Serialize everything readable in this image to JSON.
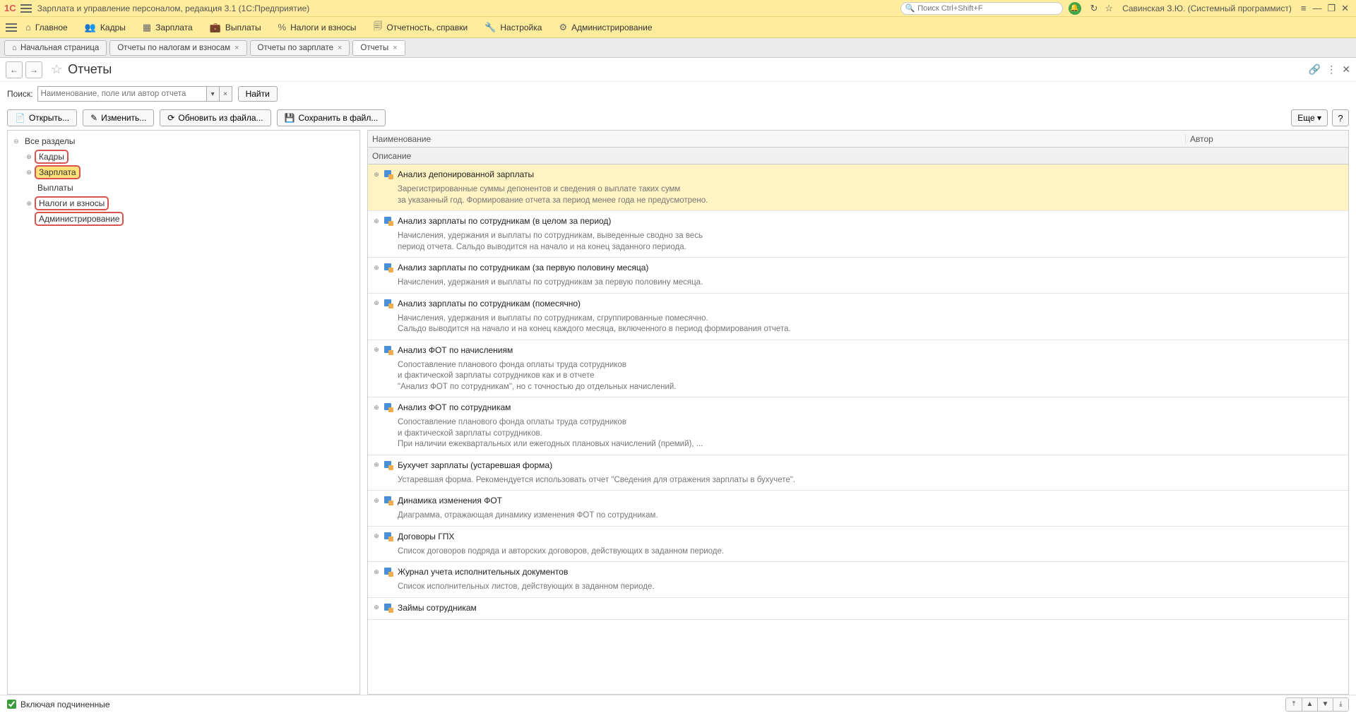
{
  "titlebar": {
    "logo": "1C",
    "title": "Зарплата и управление персоналом, редакция 3.1  (1С:Предприятие)",
    "search_placeholder": "Поиск Ctrl+Shift+F",
    "user": "Савинская З.Ю. (Системный программист)"
  },
  "mainmenu": [
    {
      "icon": "⌂",
      "label": "Главное"
    },
    {
      "icon": "👥",
      "label": "Кадры"
    },
    {
      "icon": "▦",
      "label": "Зарплата"
    },
    {
      "icon": "💼",
      "label": "Выплаты"
    },
    {
      "icon": "%",
      "label": "Налоги и взносы"
    },
    {
      "icon": "🗐",
      "label": "Отчетность, справки"
    },
    {
      "icon": "🔧",
      "label": "Настройка"
    },
    {
      "icon": "⚙",
      "label": "Администрирование"
    }
  ],
  "tabs": {
    "home": "Начальная страница",
    "items": [
      {
        "label": "Отчеты по налогам и взносам",
        "active": false
      },
      {
        "label": "Отчеты по зарплате",
        "active": false
      },
      {
        "label": "Отчеты",
        "active": true
      }
    ]
  },
  "page": {
    "title": "Отчеты"
  },
  "search": {
    "label": "Поиск:",
    "placeholder": "Наименование, поле или автор отчета",
    "find_btn": "Найти"
  },
  "toolbar": {
    "open": "Открыть...",
    "edit": "Изменить...",
    "refresh": "Обновить из файла...",
    "save": "Сохранить в файл...",
    "more": "Еще ▾",
    "help": "?"
  },
  "tree": {
    "root": "Все разделы",
    "nodes": [
      {
        "label": "Кадры",
        "hl": true,
        "exp": true
      },
      {
        "label": "Зарплата",
        "hl": true,
        "sel": true,
        "exp": true
      },
      {
        "label": "Выплаты",
        "hl": false,
        "exp": false
      },
      {
        "label": "Налоги и взносы",
        "hl": true,
        "exp": true
      },
      {
        "label": "Администрирование",
        "hl": true,
        "exp": false
      }
    ]
  },
  "list": {
    "col_name": "Наименование",
    "col_author": "Автор",
    "col_desc": "Описание"
  },
  "reports": [
    {
      "title": "Анализ депонированной зарплаты",
      "selected": true,
      "desc": "Зарегистрированные суммы депонентов и сведения о выплате таких сумм\nза указанный год. Формирование отчета за период менее года не предусмотрено."
    },
    {
      "title": "Анализ зарплаты по сотрудникам (в целом за период)",
      "desc": "Начисления, удержания и выплаты по сотрудникам, выведенные сводно за весь\nпериод отчета. Сальдо выводится на начало и на конец заданного периода."
    },
    {
      "title": "Анализ зарплаты по сотрудникам (за первую половину месяца)",
      "desc": "Начисления, удержания и выплаты по сотрудникам за первую половину месяца."
    },
    {
      "title": "Анализ зарплаты по сотрудникам (помесячно)",
      "desc": "Начисления, удержания и выплаты по сотрудникам, сгруппированные помесячно.\nСальдо выводится на начало и на конец каждого месяца, включенного в период формирования отчета."
    },
    {
      "title": "Анализ ФОТ по начислениям",
      "desc": "Сопоставление планового фонда оплаты труда сотрудников\nи фактической зарплаты сотрудников как и в отчете\n\"Анализ ФОТ по сотрудникам\", но с точностью до отдельных начислений."
    },
    {
      "title": "Анализ ФОТ по сотрудникам",
      "desc": "Сопоставление планового фонда оплаты труда сотрудников\nи фактической зарплаты сотрудников.\nПри наличии ежеквартальных или ежегодных плановых начислений (премий), ..."
    },
    {
      "title": "Бухучет зарплаты (устаревшая форма)",
      "desc": "Устаревшая форма. Рекомендуется использовать отчет \"Сведения для отражения зарплаты в бухучете\"."
    },
    {
      "title": "Динамика изменения ФОТ",
      "desc": "Диаграмма, отражающая динамику изменения ФОТ по сотрудникам."
    },
    {
      "title": "Договоры ГПХ",
      "desc": "Список договоров подряда и авторских договоров, действующих в заданном периоде."
    },
    {
      "title": "Журнал учета исполнительных документов",
      "desc": "Список исполнительных листов, действующих в заданном периоде."
    },
    {
      "title": "Займы сотрудникам",
      "desc": ""
    }
  ],
  "footer": {
    "chk_label": "Включая подчиненные"
  }
}
